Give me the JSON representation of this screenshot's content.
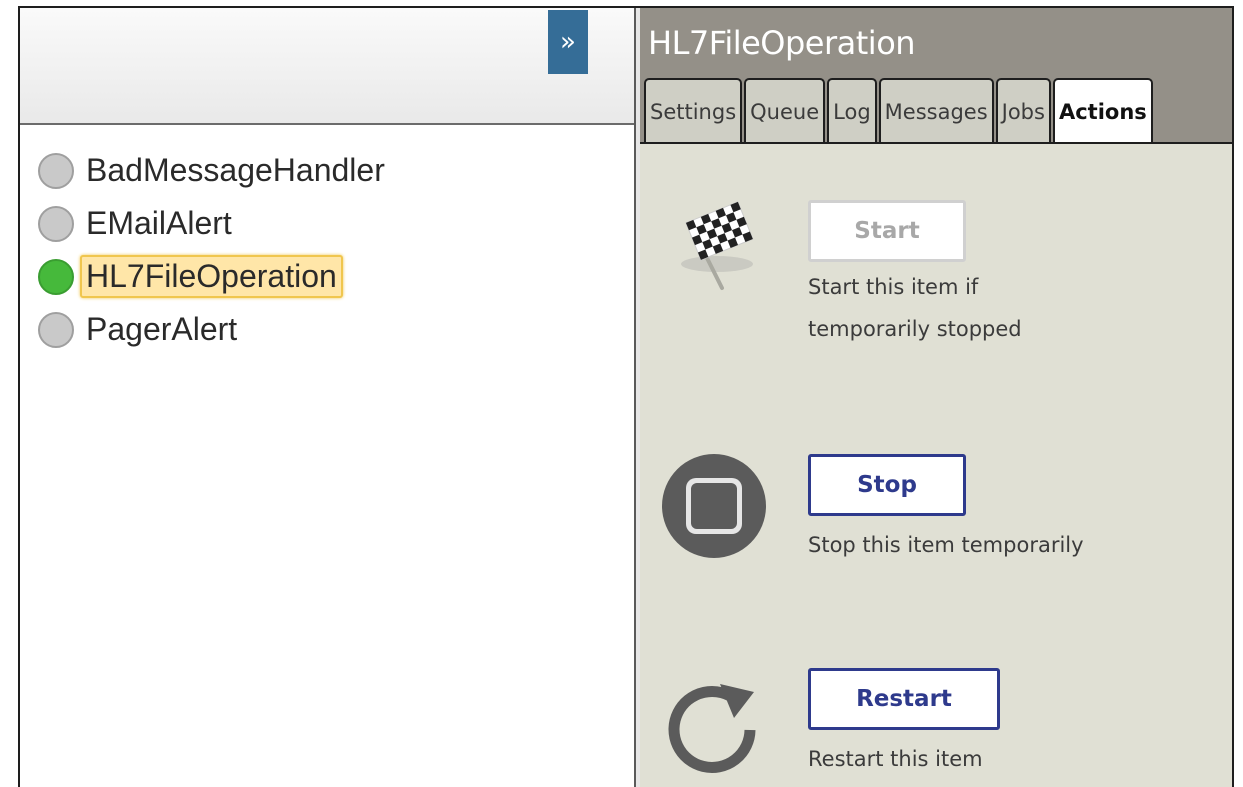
{
  "left_panel": {
    "expand_label": "»",
    "items": [
      {
        "label": "BadMessageHandler",
        "status": "stopped"
      },
      {
        "label": "EMailAlert",
        "status": "stopped"
      },
      {
        "label": "HL7FileOperation",
        "status": "running",
        "selected": true
      },
      {
        "label": "PagerAlert",
        "status": "stopped"
      }
    ]
  },
  "right_panel": {
    "title": "HL7FileOperation",
    "tabs": [
      {
        "label": "Settings"
      },
      {
        "label": "Queue"
      },
      {
        "label": "Log"
      },
      {
        "label": "Messages"
      },
      {
        "label": "Jobs"
      },
      {
        "label": "Actions",
        "active": true
      }
    ],
    "actions": {
      "start": {
        "label": "Start",
        "description": "Start this item if\ntemporarily stopped",
        "enabled": false,
        "icon": "checkered-flag-icon"
      },
      "stop": {
        "label": "Stop",
        "description": "Stop this item temporarily",
        "enabled": true,
        "icon": "stop-icon"
      },
      "restart": {
        "label": "Restart",
        "description": "Restart this item",
        "enabled": true,
        "icon": "restart-icon"
      }
    }
  },
  "colors": {
    "running": "#46b93b",
    "stopped": "#c9c9c9",
    "header_bg": "#949088",
    "button_border": "#2e3a8c",
    "selected_bg": "#ffe6a8"
  }
}
